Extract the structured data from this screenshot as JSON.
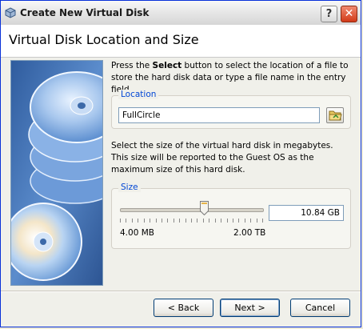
{
  "window": {
    "title": "Create New Virtual Disk",
    "help_label": "?",
    "close_label": "✕"
  },
  "header": {
    "title": "Virtual Disk Location and Size"
  },
  "location": {
    "intro_pre": "Press the ",
    "intro_bold": "Select",
    "intro_post": " button to select the location of a file to store the hard disk data or type a file name in the entry field.",
    "group_label": "Location",
    "value": "FullCircle"
  },
  "size": {
    "intro": "Select the size of the virtual hard disk in megabytes. This size will be reported to the Guest OS as the maximum size of this hard disk.",
    "group_label": "Size",
    "value": "10.84 GB",
    "min_label": "4.00 MB",
    "max_label": "2.00 TB",
    "slider_fraction": 0.59
  },
  "buttons": {
    "back": "< Back",
    "next": "Next >",
    "cancel": "Cancel"
  },
  "icons": {
    "title": "virtualbox-cube-icon",
    "folder": "folder-open-icon",
    "sidebar": "cd-discs-illustration"
  },
  "colors": {
    "group_label": "#0046d5",
    "window_border": "#0831d9",
    "close_button": "#d23a18"
  }
}
